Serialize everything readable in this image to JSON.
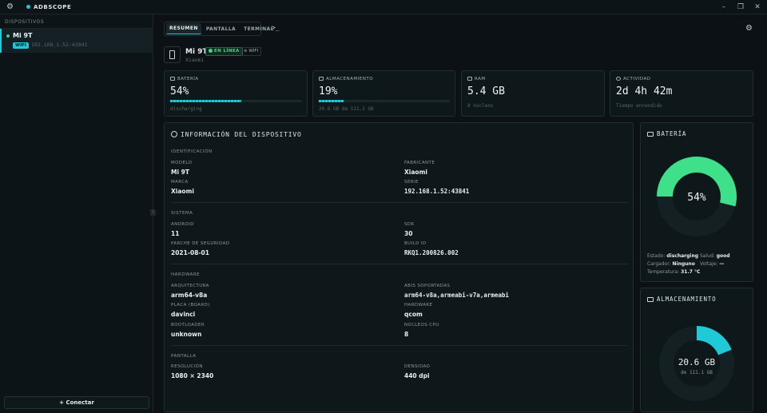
{
  "app": {
    "title": "ADBSCOPE"
  },
  "sidebar": {
    "header": "DISPOSITIVOS",
    "device": {
      "name": "Mi 9T",
      "badge": "WIFI",
      "ip": "192.168.1.52:43841"
    },
    "connect_label": "+ Conectar"
  },
  "tabs": [
    {
      "label": "RESUMEN",
      "active": true
    },
    {
      "label": "PANTALLA"
    },
    {
      "label": "TERMINAL"
    }
  ],
  "terminal_icon": ">_",
  "device_header": {
    "name": "Mi 9T",
    "status": "EN LÍNEA",
    "connection": "WIFI",
    "manufacturer": "Xiaomi"
  },
  "stats": {
    "battery": {
      "label": "BATERÍA",
      "value": "54%",
      "sub": "discharging",
      "level": 0.54
    },
    "storage": {
      "label": "ALMACENAMIENTO",
      "value": "19%",
      "sub": "20.6 GB de 111.1 GB",
      "level": 0.19
    },
    "ram": {
      "label": "RAM",
      "value": "5.4 GB",
      "sub": "8 núcleos"
    },
    "uptime": {
      "label": "ACTIVIDAD",
      "value": "2d 4h 42m",
      "sub": "Tiempo encendido"
    }
  },
  "info": {
    "title": "INFORMACIÓN DEL DISPOSITIVO",
    "identification": {
      "section": "IDENTIFICACIÓN",
      "modelo": {
        "k": "MODELO",
        "v": "Mi 9T"
      },
      "fabricante": {
        "k": "FABRICANTE",
        "v": "Xiaomi"
      },
      "marca": {
        "k": "MARCA",
        "v": "Xiaomi"
      },
      "serie": {
        "k": "SERIE",
        "v": "192.168.1.52:43841"
      }
    },
    "system": {
      "section": "SISTEMA",
      "android": {
        "k": "ANDROID",
        "v": "11"
      },
      "sdk": {
        "k": "SDK",
        "v": "30"
      },
      "patch": {
        "k": "PARCHE DE SEGURIDAD",
        "v": "2021-08-01"
      },
      "build": {
        "k": "BUILD ID",
        "v": "RKQ1.200826.002"
      }
    },
    "hardware": {
      "section": "HARDWARE",
      "arch": {
        "k": "ARQUITECTURA",
        "v": "arm64-v8a"
      },
      "abis": {
        "k": "ABIS SOPORTADAS",
        "v": "arm64-v8a,armeabi-v7a,armeabi"
      },
      "board": {
        "k": "PLACA (BOARD)",
        "v": "davinci"
      },
      "hw": {
        "k": "HARDWARE",
        "v": "qcom"
      },
      "bootloader": {
        "k": "BOOTLOADER",
        "v": "unknown"
      },
      "cores": {
        "k": "NÚCLEOS CPU",
        "v": "8"
      }
    },
    "screen": {
      "section": "PANTALLA",
      "res": {
        "k": "RESOLUCIÓN",
        "v": "1080 × 2340"
      },
      "density": {
        "k": "DENSIDAD",
        "v": "440 dpi"
      }
    }
  },
  "battery_panel": {
    "title": "BATERÍA",
    "percent_label": "54%",
    "level": 0.54,
    "color": "#3ee08a",
    "estado_k": "Estado:",
    "estado_v": "discharging",
    "salud_k": "Salud:",
    "salud_v": "good",
    "cargador_k": "Cargador:",
    "cargador_v": "Ninguno",
    "voltaje_k": "Voltaje:",
    "voltaje_v": "—",
    "temp_k": "Temperatura:",
    "temp_v": "31.7 °C"
  },
  "storage_panel": {
    "title": "ALMACENAMIENTO",
    "used": "20.6 GB",
    "total": "de 111.1 GB",
    "level": 0.19,
    "color": "#20c9d6"
  }
}
